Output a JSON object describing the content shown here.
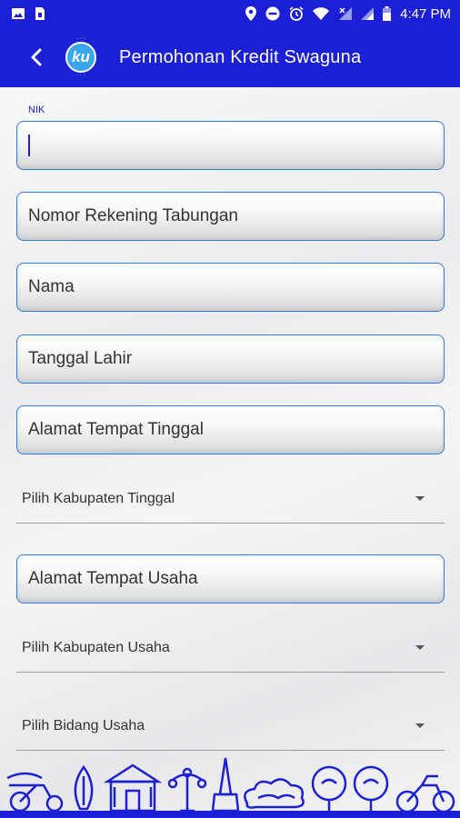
{
  "status_bar": {
    "time": "4:47 PM",
    "icons": [
      "image-icon",
      "sim-icon",
      "location-icon",
      "dnd-icon",
      "alarm-icon",
      "wifi-icon",
      "no-signal-icon",
      "signal-icon",
      "battery-icon"
    ]
  },
  "app_bar": {
    "title": "Permohonan Kredit Swaguna",
    "logo_text": "ku"
  },
  "form": {
    "nik": {
      "label": "NIK",
      "value": ""
    },
    "nomor_rekening": {
      "placeholder": "Nomor Rekening Tabungan"
    },
    "nama": {
      "placeholder": "Nama"
    },
    "tanggal_lahir": {
      "placeholder": "Tanggal Lahir"
    },
    "alamat_tinggal": {
      "placeholder": "Alamat Tempat Tinggal"
    },
    "kabupaten_tinggal": {
      "selected": "Pilih Kabupaten Tinggal"
    },
    "alamat_usaha": {
      "placeholder": "Alamat Tempat Usaha"
    },
    "kabupaten_usaha": {
      "selected": "Pilih Kabupaten Usaha"
    },
    "bidang_usaha": {
      "selected": "Pilih Bidang Usaha"
    }
  },
  "colors": {
    "primary": "#1b1fd6",
    "field_border": "#2f7be0",
    "logo": "#3aa6ef"
  }
}
